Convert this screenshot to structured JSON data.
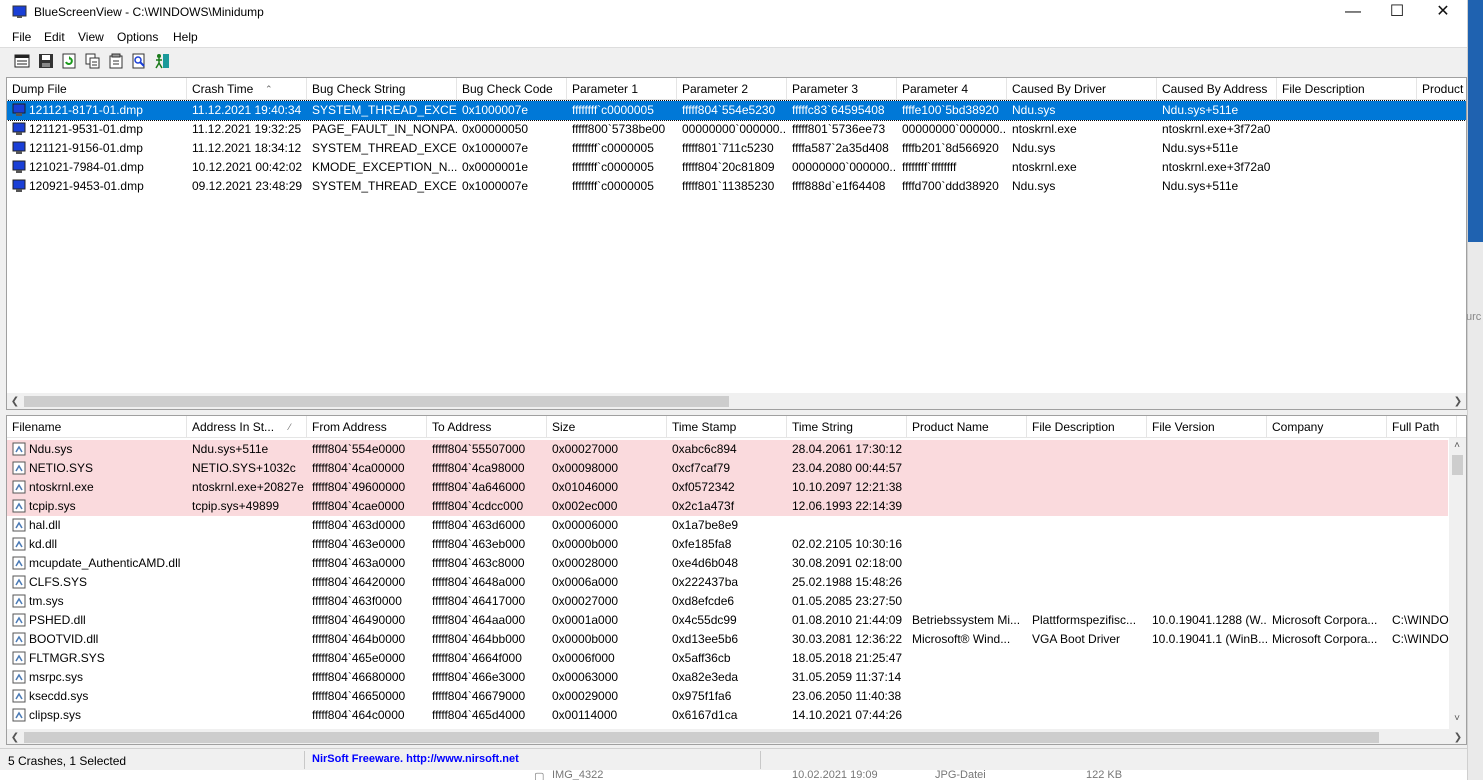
{
  "window": {
    "title": "BlueScreenView  -  C:\\WINDOWS\\Minidump",
    "minimize": "—",
    "maximize": "☐",
    "close": "✕"
  },
  "menu": [
    "File",
    "Edit",
    "View",
    "Options",
    "Help"
  ],
  "toolbar_icons": [
    "html-report-icon",
    "save-icon",
    "refresh-icon",
    "copy-icon",
    "properties-icon",
    "find-icon",
    "exit-icon"
  ],
  "crashes": {
    "columns": [
      "Dump File",
      "Crash Time",
      "Bug Check String",
      "Bug Check Code",
      "Parameter 1",
      "Parameter 2",
      "Parameter 3",
      "Parameter 4",
      "Caused By Driver",
      "Caused By Address",
      "File Description",
      "Product Name"
    ],
    "sort_indicator": "⌃",
    "rows": [
      [
        "121121-8171-01.dmp",
        "11.12.2021 19:40:34",
        "SYSTEM_THREAD_EXCE...",
        "0x1000007e",
        "ffffffff`c0000005",
        "fffff804`554e5230",
        "fffffc83`64595408",
        "ffffe100`5bd38920",
        "Ndu.sys",
        "Ndu.sys+511e",
        "",
        ""
      ],
      [
        "121121-9531-01.dmp",
        "11.12.2021 19:32:25",
        "PAGE_FAULT_IN_NONPA...",
        "0x00000050",
        "fffff800`5738be00",
        "00000000`000000...",
        "fffff801`5736ee73",
        "00000000`000000...",
        "ntoskrnl.exe",
        "ntoskrnl.exe+3f72a0",
        "",
        ""
      ],
      [
        "121121-9156-01.dmp",
        "11.12.2021 18:34:12",
        "SYSTEM_THREAD_EXCE...",
        "0x1000007e",
        "ffffffff`c0000005",
        "fffff801`711c5230",
        "ffffa587`2a35d408",
        "ffffb201`8d566920",
        "Ndu.sys",
        "Ndu.sys+511e",
        "",
        ""
      ],
      [
        "121021-7984-01.dmp",
        "10.12.2021 00:42:02",
        "KMODE_EXCEPTION_N...",
        "0x0000001e",
        "ffffffff`c0000005",
        "fffff804`20c81809",
        "00000000`000000...",
        "ffffffff`ffffffff",
        "ntoskrnl.exe",
        "ntoskrnl.exe+3f72a0",
        "",
        ""
      ],
      [
        "120921-9453-01.dmp",
        "09.12.2021 23:48:29",
        "SYSTEM_THREAD_EXCE...",
        "0x1000007e",
        "ffffffff`c0000005",
        "fffff801`11385230",
        "ffff888d`e1f64408",
        "ffffd700`ddd38920",
        "Ndu.sys",
        "Ndu.sys+511e",
        "",
        ""
      ]
    ],
    "selected": 0
  },
  "drivers": {
    "columns": [
      "Filename",
      "Address In St...",
      "From Address",
      "To Address",
      "Size",
      "Time Stamp",
      "Time String",
      "Product Name",
      "File Description",
      "File Version",
      "Company",
      "Full Path"
    ],
    "sort_indicator": "⁄",
    "highlight_count": 4,
    "rows": [
      [
        "Ndu.sys",
        "Ndu.sys+511e",
        "fffff804`554e0000",
        "fffff804`55507000",
        "0x00027000",
        "0xabc6c894",
        "28.04.2061 17:30:12",
        "",
        "",
        "",
        "",
        ""
      ],
      [
        "NETIO.SYS",
        "NETIO.SYS+1032c",
        "fffff804`4ca00000",
        "fffff804`4ca98000",
        "0x00098000",
        "0xcf7caf79",
        "23.04.2080 00:44:57",
        "",
        "",
        "",
        "",
        ""
      ],
      [
        "ntoskrnl.exe",
        "ntoskrnl.exe+20827e",
        "fffff804`49600000",
        "fffff804`4a646000",
        "0x01046000",
        "0xf0572342",
        "10.10.2097 12:21:38",
        "",
        "",
        "",
        "",
        ""
      ],
      [
        "tcpip.sys",
        "tcpip.sys+49899",
        "fffff804`4cae0000",
        "fffff804`4cdcc000",
        "0x002ec000",
        "0x2c1a473f",
        "12.06.1993 22:14:39",
        "",
        "",
        "",
        "",
        ""
      ],
      [
        "hal.dll",
        "",
        "fffff804`463d0000",
        "fffff804`463d6000",
        "0x00006000",
        "0x1a7be8e9",
        "",
        "",
        "",
        "",
        "",
        ""
      ],
      [
        "kd.dll",
        "",
        "fffff804`463e0000",
        "fffff804`463eb000",
        "0x0000b000",
        "0xfe185fa8",
        "02.02.2105 10:30:16",
        "",
        "",
        "",
        "",
        ""
      ],
      [
        "mcupdate_AuthenticAMD.dll",
        "",
        "fffff804`463a0000",
        "fffff804`463c8000",
        "0x00028000",
        "0xe4d6b048",
        "30.08.2091 02:18:00",
        "",
        "",
        "",
        "",
        ""
      ],
      [
        "CLFS.SYS",
        "",
        "fffff804`46420000",
        "fffff804`4648a000",
        "0x0006a000",
        "0x222437ba",
        "25.02.1988 15:48:26",
        "",
        "",
        "",
        "",
        ""
      ],
      [
        "tm.sys",
        "",
        "fffff804`463f0000",
        "fffff804`46417000",
        "0x00027000",
        "0xd8efcde6",
        "01.05.2085 23:27:50",
        "",
        "",
        "",
        "",
        ""
      ],
      [
        "PSHED.dll",
        "",
        "fffff804`46490000",
        "fffff804`464aa000",
        "0x0001a000",
        "0x4c55dc99",
        "01.08.2010 21:44:09",
        "Betriebssystem Mi...",
        "Plattformspezifisc...",
        "10.0.19041.1288 (W...",
        "Microsoft Corpora...",
        "C:\\WINDO"
      ],
      [
        "BOOTVID.dll",
        "",
        "fffff804`464b0000",
        "fffff804`464bb000",
        "0x0000b000",
        "0xd13ee5b6",
        "30.03.2081 12:36:22",
        "Microsoft® Wind...",
        "VGA Boot Driver",
        "10.0.19041.1 (WinB...",
        "Microsoft Corpora...",
        "C:\\WINDO"
      ],
      [
        "FLTMGR.SYS",
        "",
        "fffff804`465e0000",
        "fffff804`4664f000",
        "0x0006f000",
        "0x5aff36cb",
        "18.05.2018 21:25:47",
        "",
        "",
        "",
        "",
        ""
      ],
      [
        "msrpc.sys",
        "",
        "fffff804`46680000",
        "fffff804`466e3000",
        "0x00063000",
        "0xa82e3eda",
        "31.05.2059 11:37:14",
        "",
        "",
        "",
        "",
        ""
      ],
      [
        "ksecdd.sys",
        "",
        "fffff804`46650000",
        "fffff804`46679000",
        "0x00029000",
        "0x975f1fa6",
        "23.06.2050 11:40:38",
        "",
        "",
        "",
        "",
        ""
      ],
      [
        "clipsp.sys",
        "",
        "fffff804`464c0000",
        "fffff804`465d4000",
        "0x00114000",
        "0x6167d1ca",
        "14.10.2021 07:44:26",
        "",
        "",
        "",
        "",
        ""
      ]
    ]
  },
  "status": {
    "crashes": "5 Crashes, 1 Selected",
    "freeware": "NirSoft Freeware.  http://www.nirsoft.net"
  },
  "background_strip": {
    "right_text": "urc",
    "under_file": "IMG_4322",
    "under_date": "10.02.2021 19:09",
    "under_type": "JPG-Datei",
    "under_size": "122 KB"
  },
  "colors": {
    "selection": "#0078d7",
    "highlight_row": "#fadadd",
    "link": "#0000ff"
  }
}
